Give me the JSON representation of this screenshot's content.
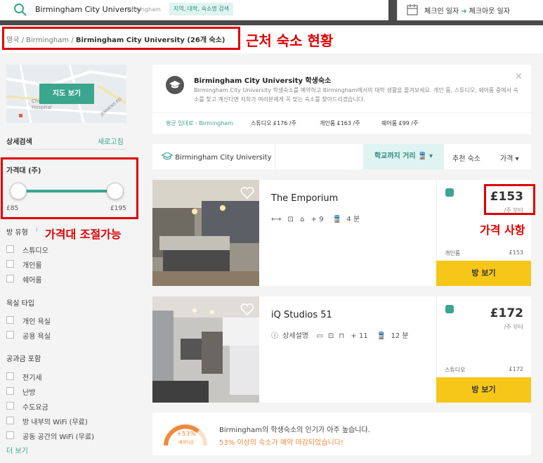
{
  "search": {
    "query": "Birmingham City University",
    "location": "Birmingham",
    "tag": "지역, 대학, 숙소명 검색"
  },
  "dates": {
    "checkin": "체크인 일자",
    "checkout": "체크아웃 일자"
  },
  "breadcrumb": {
    "country": "영국",
    "city": "Birmingham",
    "current": "Birmingham City University (26개 숙소)"
  },
  "annotations": {
    "nearby": "근처 숙소 현황",
    "price_range": "가격대 조절가능",
    "price_info": "가격 사항"
  },
  "sidebar": {
    "map_button": "지도 보기",
    "map_labels": [
      "Children's",
      "Hospital",
      "JENNENS RD"
    ],
    "detail_search": "상세검색",
    "refresh": "새로고침",
    "price_title": "가격대 (주)",
    "price_min": "£85",
    "price_max": "£195",
    "room_type": {
      "title": "방 유형",
      "info": "i",
      "items": [
        "스튜디오",
        "개인룸",
        "쉐어룸"
      ]
    },
    "bathroom": {
      "title": "욕실 타입",
      "items": [
        "개인 욕실",
        "공용 욕실"
      ]
    },
    "utilities": {
      "title": "공과금 포함",
      "items": [
        "전기세",
        "난방",
        "수도요금",
        "방 내부의 WiFi (무료)",
        "공동 공간의 WiFi (무료)"
      ]
    },
    "more": "더 보기"
  },
  "info": {
    "title": "Birmingham City University 학생숙소",
    "desc": "Birmingham City University 학생숙소를 예약하고 Birmingham에서의 대학 생활을 즐겨보세요. 개인 룸, 스튜디오, 쉐어룸 중에서 숙소를 찾고 계신다면 저희가 여러분에게 꼭 맞는 숙소를 찾아드리겠습니다.",
    "avg_label": "평균 임대료 - Birmingham",
    "avg_items": [
      "스튜디오  £176 /주",
      "개인룸  £163 /주",
      "쉐어룸  £99 /주"
    ]
  },
  "sortbar": {
    "university": "Birmingham City University",
    "distance": "학교까지 거리",
    "recommended": "추천 숙소",
    "price": "가격"
  },
  "listings": [
    {
      "name": "The Emporium",
      "amenities_more": "+ 9",
      "distance": "4 분",
      "price": "£153",
      "per": "/주 부터",
      "room": "개인룸",
      "room_price": "£153",
      "button": "방 보기"
    },
    {
      "name": "iQ Studios 51",
      "details": "상세설명",
      "amenities_more": "+ 11",
      "distance": "12 분",
      "price": "£172",
      "per": "/주 부터",
      "room": "스튜디오",
      "room_price": "£172",
      "button": "방 보기"
    }
  ],
  "popularity": {
    "percent": "+53%",
    "sub": "예약마감",
    "line1": "Birmingham의 학생숙소의 인기가 아주 높습니다.",
    "line2": "53% 이상의 숙소가 예약 마감되었습니다!"
  },
  "colors": {
    "accent": "#3aa68e",
    "button": "#f6c619",
    "highlight": "#e00000"
  }
}
